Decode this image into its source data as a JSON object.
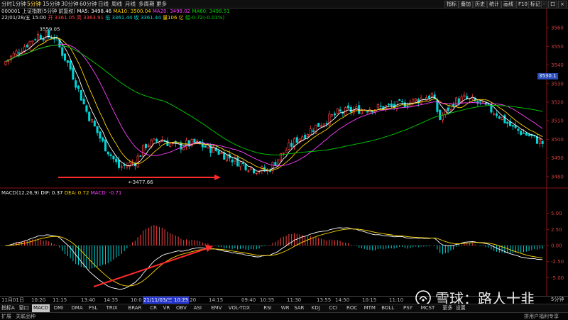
{
  "toolbar": {
    "periods": [
      "分时",
      "1分钟",
      "5分钟",
      "15分钟",
      "30分钟",
      "60分钟",
      "日线",
      "周线",
      "月线",
      "多周期",
      "更多"
    ],
    "active_period": "5分钟",
    "right_buttons": [
      "指标",
      "叠加",
      "历史",
      "统计",
      "画线",
      "F10",
      "标记",
      "-",
      "口",
      "×"
    ]
  },
  "info": {
    "code_name": "000001 上证指数(5分钟 前复权)",
    "ma5_label": "MA5: 3498.46",
    "ma10_label": "MA10: 3500.04",
    "ma20_label": "MA20: 3499.02",
    "ma60_label": "MA60: 3498.51",
    "date_time": "22/01/28/五 15:00",
    "open_label": "开 3361.05",
    "high_label": "高 3363.91",
    "low_label": "低 3361.44",
    "close_label": "收 3361.44",
    "volume_label": "量106 亿",
    "change_label": "幅-0.72(-0.01%)"
  },
  "annotations": {
    "high_marker": "3559.05",
    "low_marker": "←3477.66"
  },
  "price_tag": "3530.1",
  "macd": {
    "title": "MACD(12,26,9)",
    "dif": "DIF: 0.37",
    "dea": "DEA: 0.72",
    "macd": "MACD: -0.71"
  },
  "price_axis": {
    "labels": [
      "3560",
      "3550",
      "3540",
      "3530",
      "3520",
      "3510",
      "3500",
      "3490",
      "3480"
    ],
    "min": 3475,
    "max": 3565
  },
  "macd_axis": {
    "labels": [
      "5.00",
      "2.50",
      "0.00",
      "-2.50",
      "-5.00"
    ],
    "min": -7.5,
    "max": 7.5
  },
  "x_axis": {
    "ticks": [
      "11月01日",
      "10:20",
      "11:15",
      "13:40",
      "14:35",
      "10:0",
      "21/11/03/三 10:25",
      "13:20",
      "14:15",
      "09:40",
      "10:35",
      "11:30",
      "13:55",
      "14:50",
      "10:15",
      "11:10"
    ],
    "highlighted": "21/11/03/三 10:25",
    "frequency": "5分钟"
  },
  "indicator_tabs": [
    "指标A",
    "窗口",
    "MACD",
    "DMI",
    "DMA",
    "FSL",
    "TRIX",
    "BRAR",
    "CR",
    "VR",
    "OBV",
    "ASI",
    "EMV",
    "VOL-TDX",
    "RSI",
    "WR",
    "SAR",
    "KDJ",
    "CCI",
    "ROC",
    "MTM",
    "BOLL",
    "PSY",
    "MCST",
    "更多",
    "设置"
  ],
  "active_tab": "MACD",
  "status": {
    "left": "扩展",
    "middle": "关联品种",
    "right": "拼用户福利专享"
  },
  "watermark": "雪球：路人十韭",
  "colors": {
    "up": "#ff4040",
    "down": "#00d5d5",
    "ma5": "#ffffff",
    "ma10": "#ffd700",
    "ma20": "#ff40ff",
    "ma60": "#00d000",
    "arrow": "#ff2a2a"
  }
}
